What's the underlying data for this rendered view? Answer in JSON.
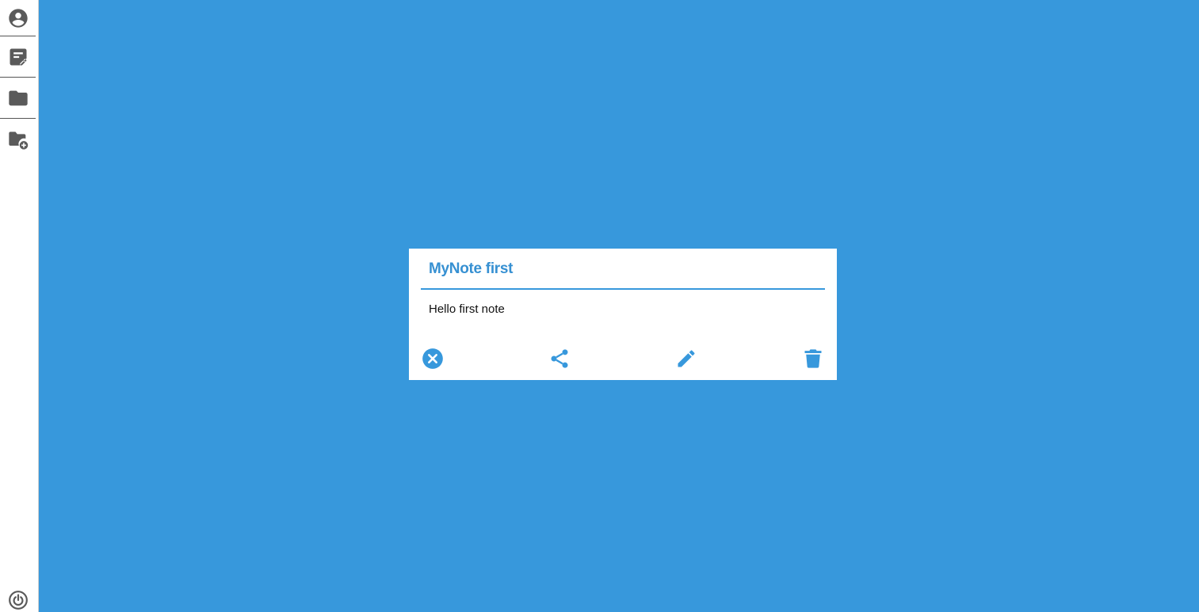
{
  "sidebar": {
    "items": [
      {
        "icon": "account-icon"
      },
      {
        "icon": "note-icon"
      },
      {
        "icon": "folder-icon"
      },
      {
        "icon": "folder-add-icon"
      }
    ],
    "logout_icon": "power-icon",
    "icon_color": "#5a5a5a"
  },
  "colors": {
    "background": "#3798dc",
    "accent": "#3798dc",
    "card": "#ffffff"
  },
  "note": {
    "title": "MyNote first",
    "body": "Hello first note",
    "actions": [
      {
        "icon": "close-circle-icon"
      },
      {
        "icon": "share-icon"
      },
      {
        "icon": "pencil-icon"
      },
      {
        "icon": "trash-icon"
      }
    ]
  }
}
